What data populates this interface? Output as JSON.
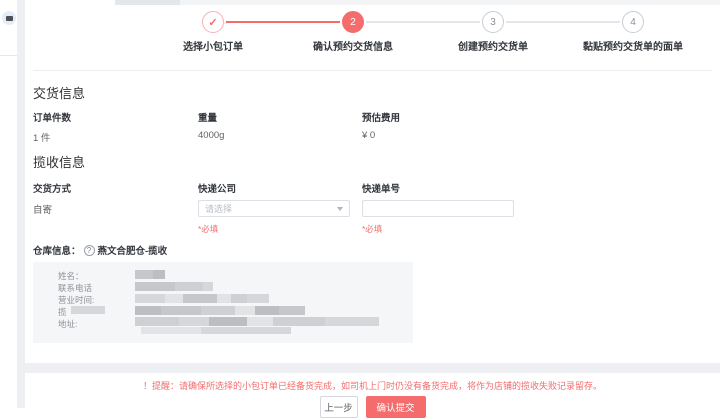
{
  "stepper": {
    "steps": [
      {
        "symbol": "✓",
        "label": "选择小包订单",
        "state": "done"
      },
      {
        "symbol": "2",
        "label": "确认预约交货信息",
        "state": "active"
      },
      {
        "symbol": "3",
        "label": "创建预约交货单",
        "state": "wait"
      },
      {
        "symbol": "4",
        "label": "黏贴预约交货单的面单",
        "state": "wait"
      }
    ]
  },
  "delivery_info": {
    "title": "交货信息",
    "fields": [
      {
        "label": "订单件数",
        "value": "1 件"
      },
      {
        "label": "重量",
        "value": "4000g"
      },
      {
        "label": "预估费用",
        "value": "¥ 0"
      }
    ]
  },
  "pickup_info": {
    "title": "揽收信息",
    "delivery_method_label": "交货方式",
    "delivery_method_value": "自寄",
    "courier_label": "快递公司",
    "courier_placeholder": "请选择",
    "tracking_label": "快递单号",
    "required_hint": "*必填"
  },
  "warehouse": {
    "label": "仓库信息：",
    "help_icon": "?",
    "name": "燕文合肥仓-揽收",
    "row_labels": [
      "姓名：",
      "联系电话",
      "营业时间:",
      "揽",
      "地址:"
    ]
  },
  "footer": {
    "reminder": "！提醒：请确保所选择的小包订单已经备货完成，如司机上门时仍没有备货完成，将作为店铺的揽收失败记录留存。",
    "prev_button": "上一步",
    "submit_button": "确认提交"
  },
  "colors": {
    "accent": "#f56c6c",
    "page_bg": "#edeff3"
  }
}
